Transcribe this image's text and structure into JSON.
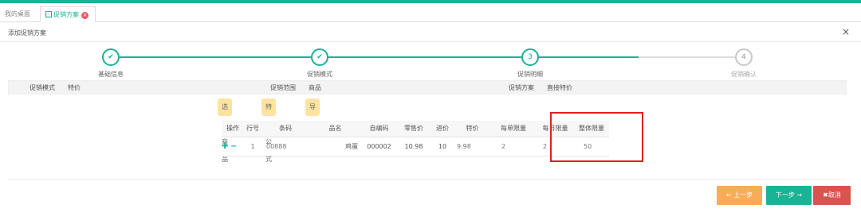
{
  "tabs": {
    "home": "我的桌面",
    "active": "促销方案"
  },
  "header": {
    "title": "添加促销方案",
    "close": "×"
  },
  "steps": [
    {
      "label": "基础信息",
      "mark": "✔",
      "status": "done"
    },
    {
      "label": "促销模式",
      "mark": "✔",
      "status": "done"
    },
    {
      "label": "促销明细",
      "mark": "3",
      "status": "current"
    },
    {
      "label": "促销确认",
      "mark": "4",
      "status": "pending"
    }
  ],
  "info": {
    "mode_label": "促销模式",
    "mode_value": "特价",
    "scope_label": "促销范围",
    "scope_value": "商品",
    "plan_label": "促销方案",
    "plan_value": "直接特价"
  },
  "actions": [
    "选择商品",
    "特价公式",
    "导入"
  ],
  "table": {
    "headers": [
      "操作",
      "行号",
      "条码",
      "品名",
      "自编码",
      "零售价",
      "进价",
      "特价",
      "每单限量",
      "每日限量",
      "整体限量"
    ],
    "rows": [
      {
        "row": "1",
        "barcode": "00888",
        "name": "鸡蛋",
        "own_code": "000002",
        "retail": "10.98",
        "cost": "10",
        "special": "9.98",
        "per_order": "2",
        "daily": "2",
        "total": "50"
      }
    ]
  },
  "footer": {
    "prev": "← 上一步",
    "next": "下一步 →",
    "cancel": "✖取消"
  },
  "colors": {
    "accent": "#1ab394",
    "warning": "#f8ac59",
    "danger": "#d9534f",
    "highlight": "#e02020"
  }
}
